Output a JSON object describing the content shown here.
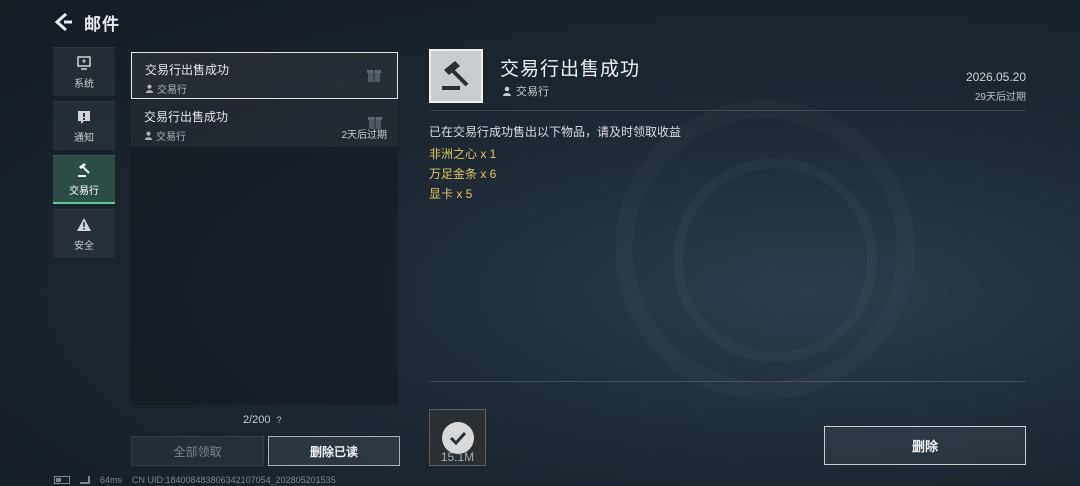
{
  "header": {
    "title": "邮件",
    "back_icon": "back-arrow-icon"
  },
  "sidebar": {
    "tabs": [
      {
        "label": "系统",
        "icon": "monitor-icon",
        "active": false
      },
      {
        "label": "通知",
        "icon": "notice-icon",
        "active": false
      },
      {
        "label": "交易行",
        "icon": "gavel-icon",
        "active": true
      },
      {
        "label": "安全",
        "icon": "warning-icon",
        "active": false
      }
    ]
  },
  "mail_list": {
    "items": [
      {
        "title": "交易行出售成功",
        "sender": "交易行",
        "expire": "",
        "selected": true
      },
      {
        "title": "交易行出售成功",
        "sender": "交易行",
        "expire": "2天后过期",
        "selected": false
      }
    ],
    "counter": "2/200",
    "help": "?",
    "claim_all_label": "全部领取",
    "delete_read_label": "删除已读"
  },
  "detail": {
    "title": "交易行出售成功",
    "sender": "交易行",
    "date": "2026.05.20",
    "expire": "29天后过期",
    "body": "已在交易行成功售出以下物品，请及时领取收益",
    "items": [
      "非洲之心 x 1",
      "万足金条 x 6",
      "显卡 x 5"
    ],
    "attachment_size": "15.1M",
    "delete_label": "删除"
  },
  "status_bar": {
    "ping": "64ms",
    "uid": "CN UID:1840084838063421070​54_202805201535"
  },
  "colors": {
    "accent": "#62c79b",
    "item_gold": "#e3c55b"
  }
}
